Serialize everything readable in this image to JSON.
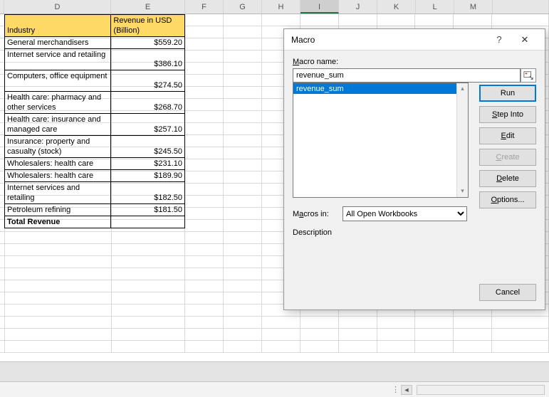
{
  "columns": [
    "D",
    "E",
    "F",
    "G",
    "H",
    "I",
    "J",
    "K",
    "L",
    "M"
  ],
  "active_column": "I",
  "table": {
    "headers": {
      "industry": "Industry",
      "revenue": "Revenue in USD (Billion)"
    },
    "rows": [
      {
        "industry": "General merchandisers",
        "revenue": "$559.20"
      },
      {
        "industry": "Internet service and retailing",
        "revenue": "$386.10"
      },
      {
        "industry": "Computers, office equipment",
        "revenue": "$274.50"
      },
      {
        "industry": "Health care: pharmacy and other services",
        "revenue": "$268.70"
      },
      {
        "industry": "Health care: insurance and managed care",
        "revenue": "$257.10"
      },
      {
        "industry": "Insurance: property and casualty (stock)",
        "revenue": "$245.50"
      },
      {
        "industry": "Wholesalers: health care",
        "revenue": "$231.10"
      },
      {
        "industry": "Wholesalers: health care",
        "revenue": "$189.90"
      },
      {
        "industry": "Internet services and retailing",
        "revenue": "$182.50"
      },
      {
        "industry": "Petroleum refining",
        "revenue": "$181.50"
      }
    ],
    "total_label": "Total Revenue"
  },
  "dialog": {
    "title": "Macro",
    "name_label": "Macro name:",
    "name_value": "revenue_sum",
    "list": [
      "revenue_sum"
    ],
    "macros_in_label": "Macros in:",
    "macros_in_value": "All Open Workbooks",
    "description_label": "Description",
    "buttons": {
      "run": "Run",
      "step": "Step Into",
      "edit": "Edit",
      "create": "Create",
      "delete": "Delete",
      "options": "Options...",
      "cancel": "Cancel"
    }
  },
  "chart_data": {
    "type": "table",
    "title": "Revenue in USD (Billion) by Industry",
    "columns": [
      "Industry",
      "Revenue in USD (Billion)"
    ],
    "rows": [
      [
        "General merchandisers",
        559.2
      ],
      [
        "Internet service and retailing",
        386.1
      ],
      [
        "Computers, office equipment",
        274.5
      ],
      [
        "Health care: pharmacy and other services",
        268.7
      ],
      [
        "Health care: insurance and managed care",
        257.1
      ],
      [
        "Insurance: property and casualty (stock)",
        245.5
      ],
      [
        "Wholesalers: health care",
        231.1
      ],
      [
        "Wholesalers: health care",
        189.9
      ],
      [
        "Internet services and retailing",
        182.5
      ],
      [
        "Petroleum refining",
        181.5
      ]
    ]
  }
}
